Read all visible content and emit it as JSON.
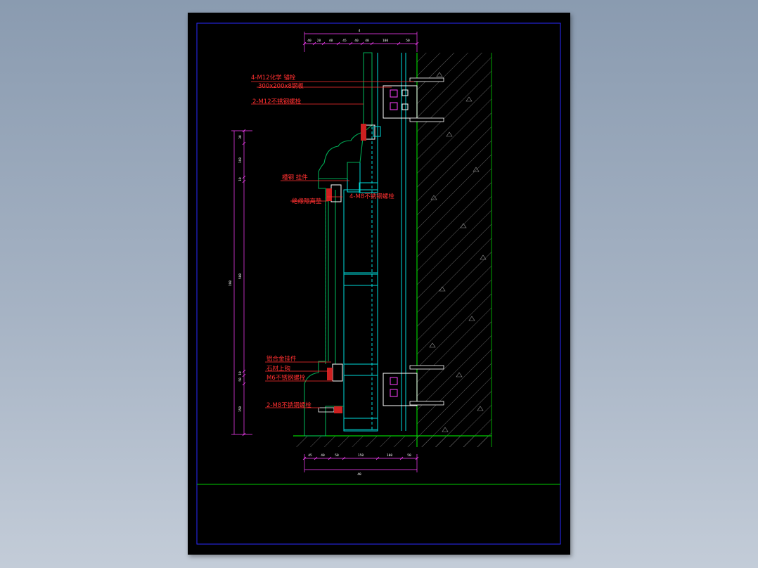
{
  "colors": {
    "background": "#97a6b8",
    "sheet": "#000000",
    "frame": "#2a2aff",
    "title_line": "#00cc00",
    "wall_hatch": "#00cc00",
    "keel": "#00dcdc",
    "stone": "#00aa55",
    "leader": "#ff3030",
    "dimension": "#ff40ff",
    "fastener": "#ffffff"
  },
  "annotations": [
    {
      "id": "anchor-bolt",
      "text": "4-M12化学 锚栓"
    },
    {
      "id": "embed-plate",
      "text": "300x200x8钢板"
    },
    {
      "id": "stainless-bolt",
      "text": "2-M12不锈钢螺栓"
    },
    {
      "id": "steel-channel",
      "text": "槽钢 挂件"
    },
    {
      "id": "stone-hook",
      "text": "4-M8不锈钢螺栓"
    },
    {
      "id": "insulation-gasket",
      "text": "绝缘隔离垫"
    },
    {
      "id": "aluminum-bracket",
      "text": "铝合金挂件"
    },
    {
      "id": "stone-upper-hook",
      "text": "石材上钩"
    },
    {
      "id": "bracket-bolt",
      "text": "M6不锈钢螺栓"
    },
    {
      "id": "bottom-bolt",
      "text": "2-M8不锈钢螺栓"
    }
  ],
  "dimensions": {
    "top_total": "4",
    "top_segments": [
      "40",
      "20",
      "40",
      "45",
      "40",
      "40",
      "100",
      "50"
    ],
    "bottom_total": "40",
    "bottom_segments": [
      "45",
      "40",
      "50",
      "150",
      "100",
      "50"
    ],
    "left_total": "190",
    "left_segments": [
      "30",
      "160",
      "10",
      "500",
      "10",
      "50",
      "150"
    ]
  }
}
